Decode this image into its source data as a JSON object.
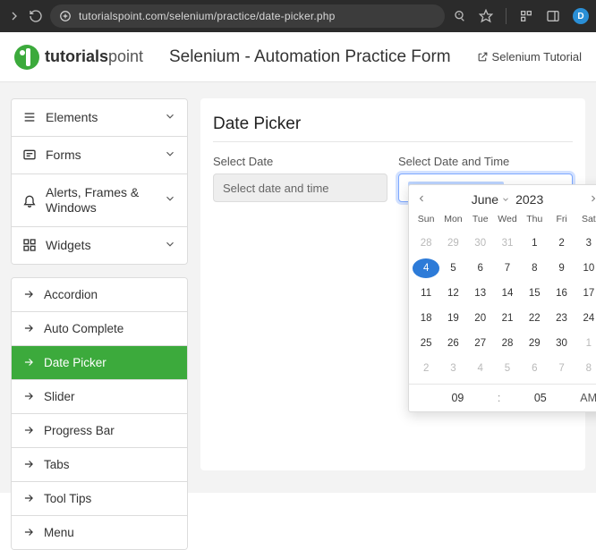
{
  "browser": {
    "url": "tutorialspoint.com/selenium/practice/date-picker.php",
    "avatar_initial": "D"
  },
  "logo_text": {
    "bold": "tutorials",
    "light": "point"
  },
  "header": {
    "title": "Selenium - Automation Practice Form",
    "tutorial_link": "Selenium Tutorial"
  },
  "sidebar": {
    "sections": [
      {
        "label": "Elements"
      },
      {
        "label": "Forms"
      },
      {
        "label": "Alerts, Frames & Windows"
      },
      {
        "label": "Widgets"
      }
    ],
    "widgets": [
      {
        "label": "Accordion"
      },
      {
        "label": "Auto Complete"
      },
      {
        "label": "Date Picker"
      },
      {
        "label": "Slider"
      },
      {
        "label": "Progress Bar"
      },
      {
        "label": "Tabs"
      },
      {
        "label": "Tool Tips"
      },
      {
        "label": "Menu"
      }
    ],
    "active_widget": "Date Picker"
  },
  "panel": {
    "heading": "Date Picker",
    "label_date": "Select Date",
    "placeholder_date": "Select date and time",
    "label_datetime": "Select Date and Time",
    "value_datetime": "2023-06-04 09:05"
  },
  "calendar": {
    "month": "June",
    "year": "2023",
    "dow": [
      "Sun",
      "Mon",
      "Tue",
      "Wed",
      "Thu",
      "Fri",
      "Sat"
    ],
    "selected_day": 4,
    "days": [
      {
        "n": 28,
        "o": true
      },
      {
        "n": 29,
        "o": true
      },
      {
        "n": 30,
        "o": true
      },
      {
        "n": 31,
        "o": true
      },
      {
        "n": 1
      },
      {
        "n": 2
      },
      {
        "n": 3
      },
      {
        "n": 4,
        "sel": true
      },
      {
        "n": 5
      },
      {
        "n": 6
      },
      {
        "n": 7
      },
      {
        "n": 8
      },
      {
        "n": 9
      },
      {
        "n": 10
      },
      {
        "n": 11
      },
      {
        "n": 12
      },
      {
        "n": 13
      },
      {
        "n": 14
      },
      {
        "n": 15
      },
      {
        "n": 16
      },
      {
        "n": 17
      },
      {
        "n": 18
      },
      {
        "n": 19
      },
      {
        "n": 20
      },
      {
        "n": 21
      },
      {
        "n": 22
      },
      {
        "n": 23
      },
      {
        "n": 24
      },
      {
        "n": 25
      },
      {
        "n": 26
      },
      {
        "n": 27
      },
      {
        "n": 28
      },
      {
        "n": 29
      },
      {
        "n": 30
      },
      {
        "n": 1,
        "o": true
      },
      {
        "n": 2,
        "o": true
      },
      {
        "n": 3,
        "o": true
      },
      {
        "n": 4,
        "o": true
      },
      {
        "n": 5,
        "o": true
      },
      {
        "n": 6,
        "o": true
      },
      {
        "n": 7,
        "o": true
      },
      {
        "n": 8,
        "o": true
      }
    ],
    "time": {
      "hour": "09",
      "minute": "05",
      "ampm": "AM"
    }
  }
}
